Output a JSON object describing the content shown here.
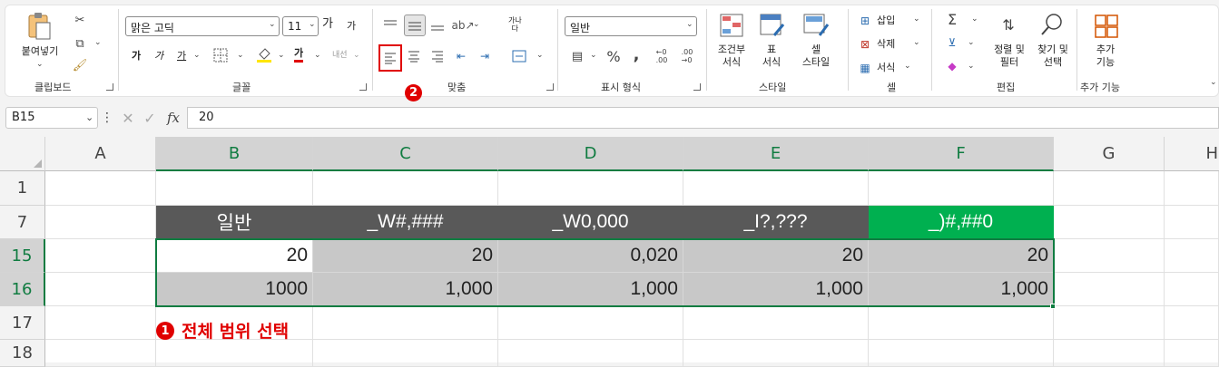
{
  "ribbon": {
    "clipboard": {
      "paste_label": "붙여넣기",
      "group_label": "클립보드"
    },
    "font": {
      "font_name": "맑은 고딕",
      "font_size": "11",
      "grow_label": "가",
      "shrink_label": "가",
      "bold_label": "가",
      "italic_label": "가",
      "underline_label": "가",
      "font_color_label": "가",
      "phonetic_label": "내선",
      "group_label": "글꼴"
    },
    "alignment": {
      "wrap_label": "가나\n다",
      "group_label": "맞춤"
    },
    "number": {
      "format_value": "일반",
      "group_label": "표시 형식"
    },
    "styles": {
      "cond_format_label": "조건부\n서식",
      "table_label": "표\n서식",
      "cell_style_label": "셀\n스타일",
      "group_label": "스타일"
    },
    "cells": {
      "insert_label": "삽입",
      "delete_label": "삭제",
      "format_label": "서식",
      "group_label": "셀"
    },
    "editing": {
      "sort_label": "정렬 및\n필터",
      "find_label": "찾기 및\n선택",
      "group_label": "편집"
    },
    "addins": {
      "addins_label": "추가\n기능",
      "group_label": "추가 기능"
    }
  },
  "formula_bar": {
    "name_box": "B15",
    "fx_label": "fx",
    "formula": "20"
  },
  "grid": {
    "columns": [
      "A",
      "B",
      "C",
      "D",
      "E",
      "F",
      "G",
      "H"
    ],
    "rows": [
      "1",
      "7",
      "15",
      "16",
      "17",
      "18"
    ],
    "header_row": [
      "일반",
      "_W#,###",
      "_W0,000",
      "_I?,???",
      "_)#,##0"
    ],
    "row15": [
      "20",
      "20",
      "0,020",
      "20",
      "20"
    ],
    "row16": [
      "1000",
      "1,000",
      "1,000",
      "1,000",
      "1,000"
    ]
  },
  "annotations": {
    "step1_number": "1",
    "step1_text": "전체 범위 선택",
    "step2_number": "2",
    "color": "#e00000"
  },
  "colors": {
    "excel_green": "#107c41",
    "header_gray": "#595959",
    "header_green": "#00b050",
    "selection_fill": "#c8c8c8"
  }
}
